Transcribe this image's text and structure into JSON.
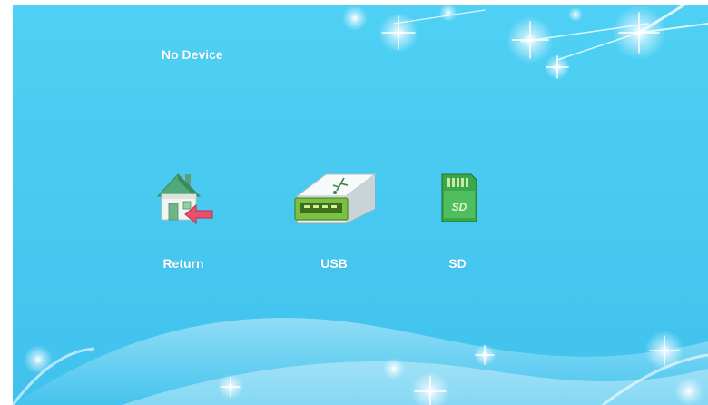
{
  "status": {
    "text": "No Device"
  },
  "menu": {
    "items": [
      {
        "label": "Return",
        "icon": "home-return-icon"
      },
      {
        "label": "USB",
        "icon": "usb-drive-icon"
      },
      {
        "label": "SD",
        "icon": "sd-card-icon",
        "icon_text": "SD"
      }
    ]
  },
  "colors": {
    "background": "#46c8f0",
    "text": "#ffffff",
    "sd_card": "#3aa84a",
    "usb_connector": "#7ac043",
    "return_arrow": "#e8506a"
  }
}
